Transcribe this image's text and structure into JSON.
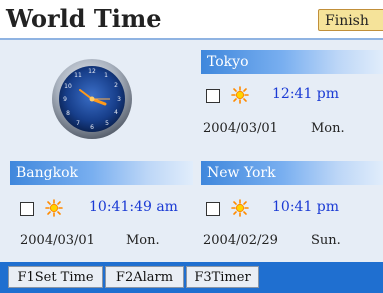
{
  "app": {
    "title": "World Time",
    "finish_label": "Finish"
  },
  "cities": {
    "tokyo": {
      "name": "Tokyo",
      "time": "12:41 pm",
      "date": "2004/03/01",
      "day": "Mon."
    },
    "bangkok": {
      "name": "Bangkok",
      "time": "10:41:49 am",
      "date": "2004/03/01",
      "day": "Mon."
    },
    "newyork": {
      "name": "New York",
      "time": "10:41 pm",
      "date": "2004/02/29",
      "day": "Sun."
    }
  },
  "footer": {
    "keys": [
      {
        "label": "F1Set Time"
      },
      {
        "label": "F2Alarm"
      },
      {
        "label": "F3Timer"
      }
    ]
  },
  "colors": {
    "accent_blue": "#1f6fd0",
    "time_blue": "#1a3ad4",
    "finish_bg": "#f5e39a"
  },
  "icons": {
    "clock": "analog-clock-icon",
    "dst": "sun-icon",
    "checkbox": "checkbox-icon"
  }
}
